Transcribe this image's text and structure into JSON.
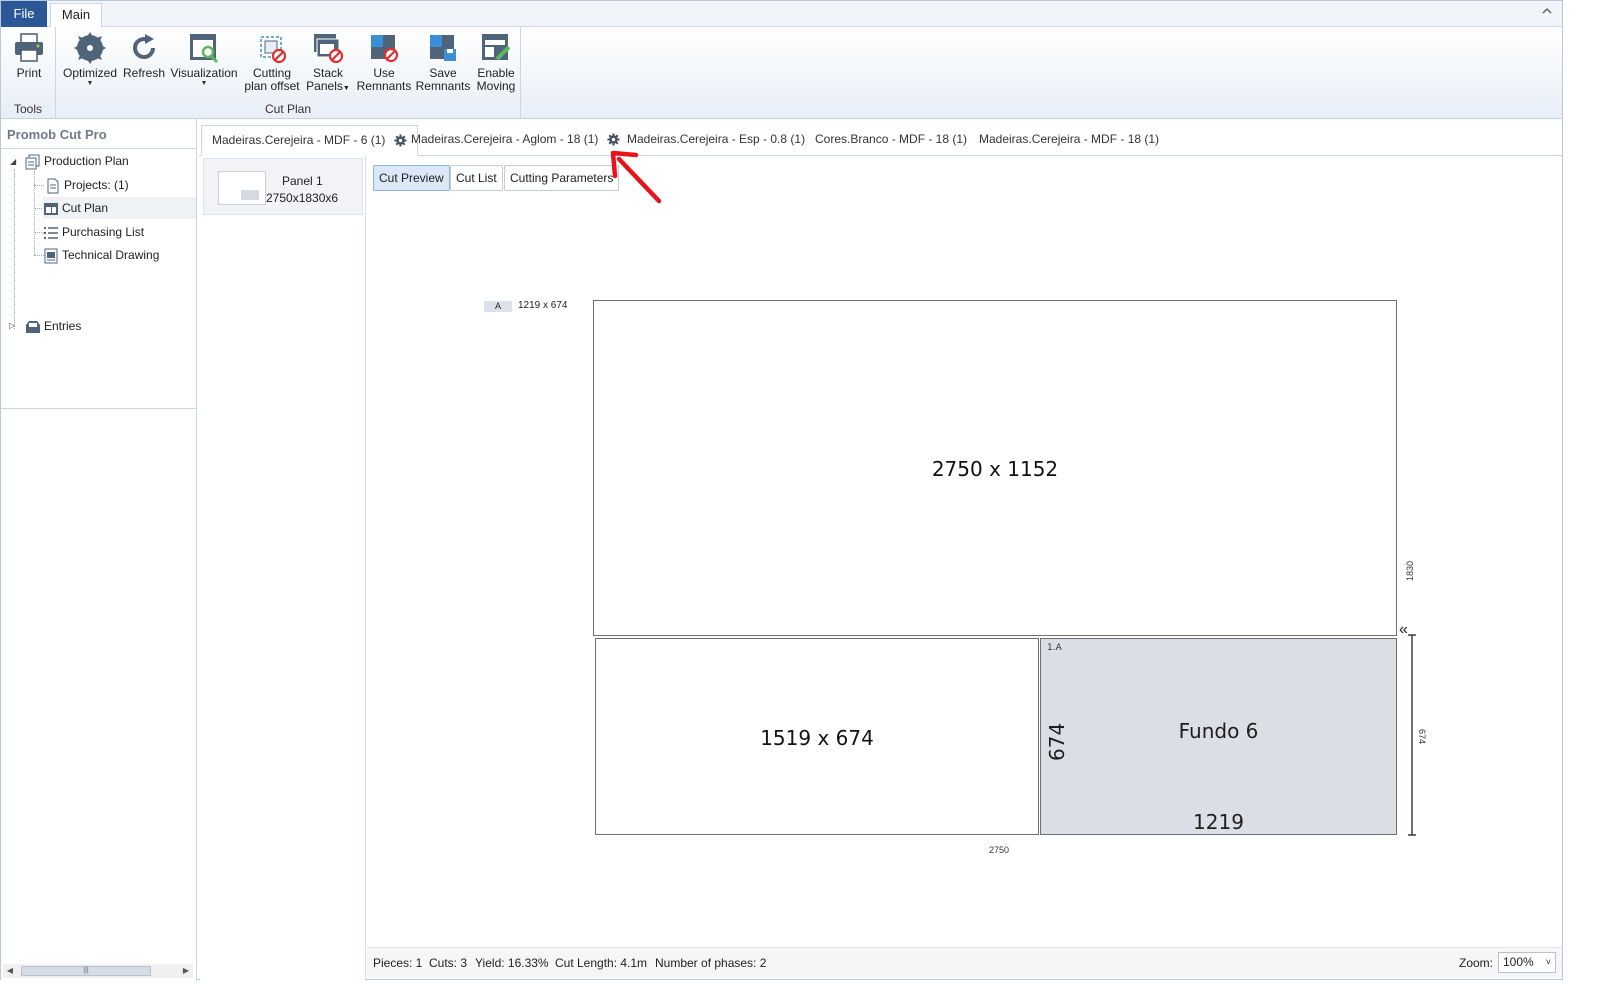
{
  "ribbon": {
    "file_tab": "File",
    "main_tab": "Main",
    "groups": {
      "tools": {
        "label": "Tools",
        "print": "Print"
      },
      "cut_plan": {
        "label": "Cut Plan",
        "optimized": "Optimized",
        "refresh": "Refresh",
        "visualization": "Visualization",
        "cutting_offset_1": "Cutting",
        "cutting_offset_2": "plan offset",
        "stack_1": "Stack",
        "stack_2": "Panels",
        "use_rem_1": "Use",
        "use_rem_2": "Remnants",
        "save_rem_1": "Save",
        "save_rem_2": "Remnants",
        "enable_1": "Enable",
        "enable_2": "Moving"
      }
    }
  },
  "left": {
    "title": "Promob Cut Pro",
    "tree": {
      "production_plan": "Production Plan",
      "projects": "Projects: (1)",
      "cut_plan": "Cut Plan",
      "purchasing_list": "Purchasing List",
      "technical_drawing": "Technical Drawing",
      "entries": "Entries"
    }
  },
  "doc_tabs": [
    "Madeiras.Cerejeira - MDF - 6 (1)",
    "Madeiras.Cerejeira - Aglom - 18 (1)",
    "Madeiras.Cerejeira - Esp - 0.8 (1)",
    "Cores.Branco - MDF - 18 (1)",
    "Madeiras.Cerejeira - MDF - 18 (1)"
  ],
  "panels": [
    {
      "name": "Panel 1",
      "size": "2750x1830x6"
    }
  ],
  "subtabs": {
    "cut_preview": "Cut Preview",
    "cut_list": "Cut List",
    "cutting_parameters": "Cutting Parameters"
  },
  "plan": {
    "badge": "A",
    "badge_size": "1219 x 674",
    "top_region": "2750 x 1152",
    "bottom_left_region": "1519 x 674",
    "piece": {
      "id": "1.A",
      "name": "Fundo 6",
      "width": "1219",
      "height": "674"
    },
    "right_dim_total": "1830",
    "right_dim_piece": "674",
    "bottom_dim": "2750",
    "double_chevron": "«"
  },
  "status": {
    "pieces": "Pieces: 1",
    "cuts": "Cuts: 3",
    "yield": "Yield: 16.33%",
    "cut_length": "Cut Length: 4.1m",
    "phases": "Number of phases: 2",
    "zoom_label": "Zoom:",
    "zoom_value": "100%"
  },
  "colors": {
    "file_tab": "#2b5797",
    "piece_fill": "#dcdee5",
    "annotation_arrow": "#e8141a"
  }
}
